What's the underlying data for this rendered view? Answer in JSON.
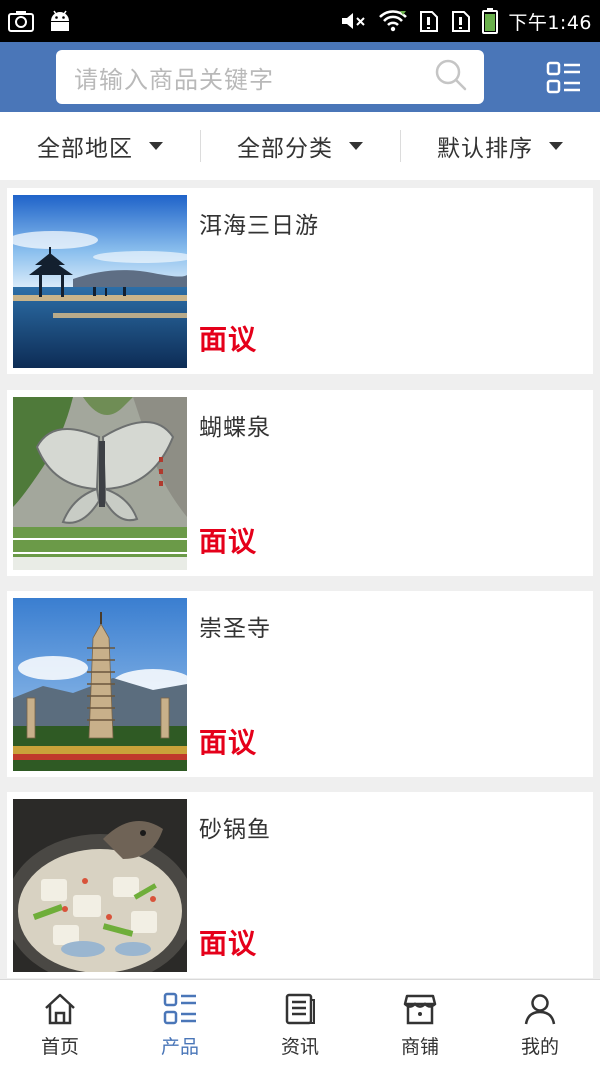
{
  "status_bar": {
    "time": "下午1:46",
    "icons": [
      "screenshot-icon",
      "android-icon",
      "mute-icon",
      "wifi-icon",
      "sim1-icon",
      "sim2-icon",
      "battery-icon"
    ]
  },
  "search": {
    "placeholder": "请输入商品关键字"
  },
  "filters": [
    {
      "label": "全部地区"
    },
    {
      "label": "全部分类"
    },
    {
      "label": "默认排序"
    }
  ],
  "products": [
    {
      "name": "洱海三日游",
      "price": "面议",
      "image": "lake-pavilion"
    },
    {
      "name": "蝴蝶泉",
      "price": "面议",
      "image": "butterfly-sculpture"
    },
    {
      "name": "崇圣寺",
      "price": "面议",
      "image": "pagodas"
    },
    {
      "name": "砂锅鱼",
      "price": "面议",
      "image": "fish-hotpot"
    }
  ],
  "tabs": [
    {
      "label": "首页",
      "icon": "home-icon"
    },
    {
      "label": "产品",
      "icon": "grid-list-icon",
      "active": true
    },
    {
      "label": "资讯",
      "icon": "news-icon"
    },
    {
      "label": "商铺",
      "icon": "store-icon"
    },
    {
      "label": "我的",
      "icon": "user-icon"
    }
  ],
  "colors": {
    "header": "#4a76b8",
    "price": "#e5001a",
    "active_tab": "#4a76b8"
  }
}
